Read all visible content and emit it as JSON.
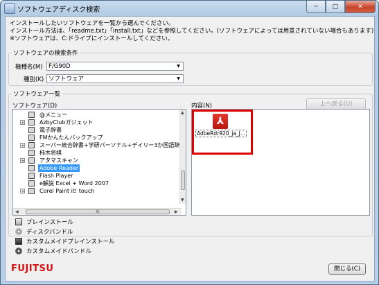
{
  "window": {
    "title": "ソフトウェアディスク検索",
    "caption_min": "─",
    "caption_max": "□",
    "caption_close": "✕"
  },
  "instructions": [
    "インストールしたいソフトウェアを一覧から選んでください。",
    "インストール方法は、「readme.txt」「install.txt」などを参照してください。(ソフトウェアによっては用意されていない場合もあります)",
    "※ソフトウェアは、C:ドライブにインストールしてください。"
  ],
  "search_conditions": {
    "legend": "ソフトウェアの検索条件",
    "model_label": "機種名(M)",
    "model_value": "F/G90D",
    "type_label": "種別(K)",
    "type_value": "ソフトウェア"
  },
  "software_list": {
    "legend": "ソフトウェア一覧",
    "tree_label": "ソフトウェア(D)",
    "content_label": "内容(N)",
    "up_button": "上へ戻る(U)",
    "items": [
      {
        "label": "@メニュー",
        "expandable": false,
        "selected": false
      },
      {
        "label": "AzbyClubガジェット",
        "expandable": true,
        "selected": false
      },
      {
        "label": "電子辞書",
        "expandable": false,
        "selected": false
      },
      {
        "label": "FMかんたんバックアップ",
        "expandable": false,
        "selected": false
      },
      {
        "label": "スーパー統合辞書+学研パーソナル+デイリー3か国語辞",
        "expandable": true,
        "selected": false
      },
      {
        "label": "柿木将棋",
        "expandable": false,
        "selected": false
      },
      {
        "label": "アタマスキャン",
        "expandable": true,
        "selected": false
      },
      {
        "label": "Adobe Reader",
        "expandable": false,
        "selected": true
      },
      {
        "label": "Flash Player",
        "expandable": false,
        "selected": false
      },
      {
        "label": "e解説 Excel + Word 2007",
        "expandable": false,
        "selected": false
      },
      {
        "label": "Corel Paint it! touch",
        "expandable": true,
        "selected": false
      }
    ],
    "hscroll_grip": "III",
    "content_items": [
      {
        "label": "AdbeRdr920_ja_J...",
        "icon": "pdf-icon"
      }
    ]
  },
  "legend_items": [
    {
      "icon": "preinstall-icon",
      "label": "プレインストール"
    },
    {
      "icon": "disc-bundle-icon",
      "label": "ディスクバンドル"
    },
    {
      "icon": "custom-preinstall-icon",
      "label": "カスタムメイドプレインストール"
    },
    {
      "icon": "custom-bundle-icon",
      "label": "カスタムメイドバンドル"
    }
  ],
  "brand": "FUJITSU",
  "close_button": "閉じる(C)"
}
